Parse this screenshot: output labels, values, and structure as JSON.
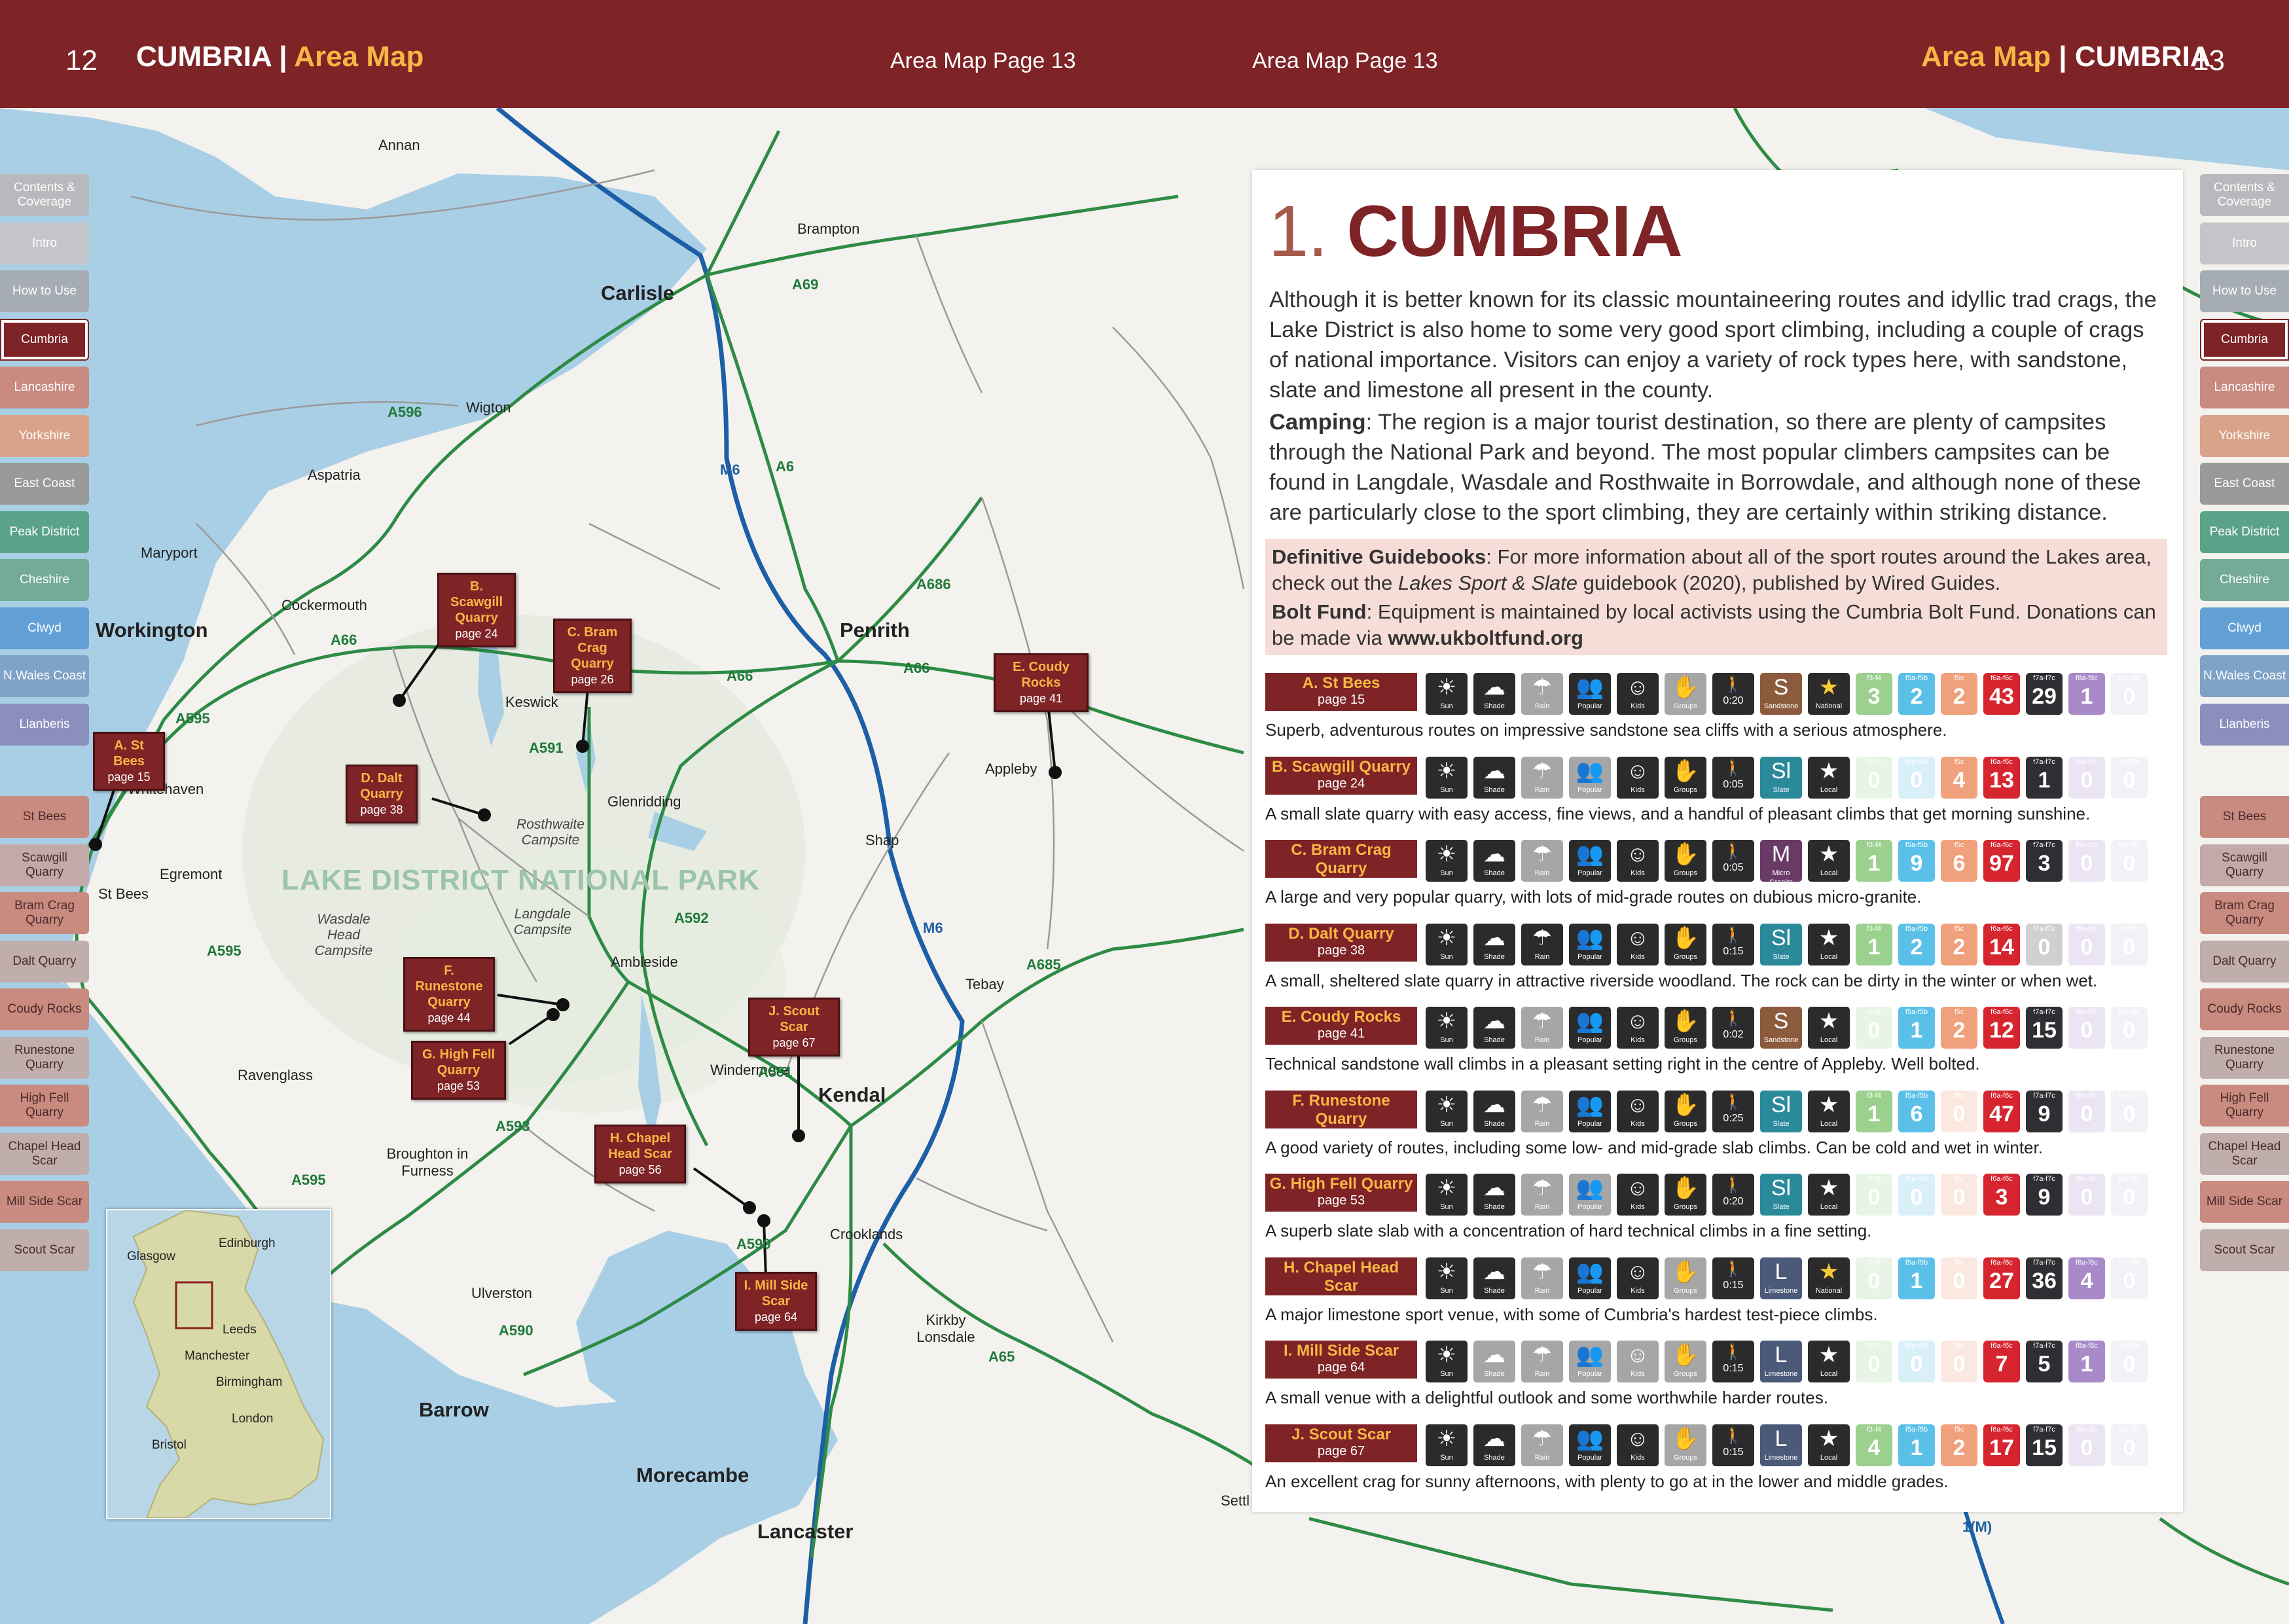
{
  "header": {
    "left_page_num": "12",
    "left_title": "CUMBRIA",
    "left_subtitle": "Area Map",
    "left_small": "Area Map Page 13",
    "right_small": "Area Map Page 13",
    "right_subtitle": "Area Map",
    "right_title": "CUMBRIA",
    "right_page_num": "13"
  },
  "colors": {
    "header": "#7e2326",
    "accent": "#f7b744",
    "road": "#1f7a3a",
    "motorway": "#1d5fa6",
    "sea": "#a9cfe6"
  },
  "tabs": [
    {
      "label": "Contents & Coverage",
      "color": "#b9b9bd"
    },
    {
      "label": "Intro",
      "color": "#c5c5c9"
    },
    {
      "label": "How to Use",
      "color": "#a6acb4"
    },
    {
      "label": "Cumbria",
      "color": "#7e2326",
      "active": true
    },
    {
      "label": "Lancashire",
      "color": "#c98a7f"
    },
    {
      "label": "Yorkshire",
      "color": "#d9a38a"
    },
    {
      "label": "East Coast",
      "color": "#9a9a9a"
    },
    {
      "label": "Peak District",
      "color": "#5aa389"
    },
    {
      "label": "Cheshire",
      "color": "#73ab96"
    },
    {
      "label": "Clwyd",
      "color": "#62a0d6"
    },
    {
      "label": "N.Wales Coast",
      "color": "#7fa2c7"
    },
    {
      "label": "Llanberis",
      "color": "#8b8fbe"
    }
  ],
  "crag_tabs": [
    {
      "label": "St Bees",
      "color": "#c98a7f"
    },
    {
      "label": "Scawgill Quarry",
      "color": "#c3a9a8"
    },
    {
      "label": "Bram Crag Quarry",
      "color": "#c98a7f"
    },
    {
      "label": "Dalt Quarry",
      "color": "#bfaeac"
    },
    {
      "label": "Coudy Rocks",
      "color": "#c98a7f"
    },
    {
      "label": "Runestone Quarry",
      "color": "#bfaeac"
    },
    {
      "label": "High Fell Quarry",
      "color": "#c98a7f"
    },
    {
      "label": "Chapel Head Scar",
      "color": "#bfaeac"
    },
    {
      "label": "Mill Side Scar",
      "color": "#c98a7f"
    },
    {
      "label": "Scout Scar",
      "color": "#bfaeac"
    }
  ],
  "map": {
    "park_label": "LAKE DISTRICT NATIONAL PARK",
    "places": [
      {
        "id": "annan",
        "name": "Annan"
      },
      {
        "id": "brampton",
        "name": "Brampton"
      },
      {
        "id": "carlisle",
        "name": "Carlisle",
        "big": true
      },
      {
        "id": "wigton",
        "name": "Wigton"
      },
      {
        "id": "aspatria",
        "name": "Aspatria"
      },
      {
        "id": "maryport",
        "name": "Maryport"
      },
      {
        "id": "cockermouth",
        "name": "Cockermouth"
      },
      {
        "id": "workington",
        "name": "Workington",
        "big": true
      },
      {
        "id": "keswick",
        "name": "Keswick"
      },
      {
        "id": "penrith",
        "name": "Penrith",
        "big": true
      },
      {
        "id": "appleby",
        "name": "Appleby"
      },
      {
        "id": "whitehaven",
        "name": "Whitehaven"
      },
      {
        "id": "egremont",
        "name": "Egremont"
      },
      {
        "id": "stbees",
        "name": "St Bees"
      },
      {
        "id": "glenridding",
        "name": "Glenridding"
      },
      {
        "id": "shap",
        "name": "Shap"
      },
      {
        "id": "tebay",
        "name": "Tebay"
      },
      {
        "id": "ambleside",
        "name": "Ambleside"
      },
      {
        "id": "ravenglass",
        "name": "Ravenglass"
      },
      {
        "id": "windermere",
        "name": "Windermere"
      },
      {
        "id": "kendal",
        "name": "Kendal",
        "big": true
      },
      {
        "id": "broughton",
        "name": "Broughton in Furness"
      },
      {
        "id": "crooklands",
        "name": "Crooklands"
      },
      {
        "id": "ulverston",
        "name": "Ulverston"
      },
      {
        "id": "kirkby",
        "name": "Kirkby Lonsdale"
      },
      {
        "id": "barrow",
        "name": "Barrow",
        "big": true
      },
      {
        "id": "morecambe",
        "name": "Morecambe",
        "big": true
      },
      {
        "id": "lancaster",
        "name": "Lancaster",
        "big": true
      },
      {
        "id": "settle",
        "name": "Settl"
      }
    ],
    "campsites": [
      {
        "id": "rosthwaite",
        "name": "Rosthwaite Campsite"
      },
      {
        "id": "wasdale",
        "name": "Wasdale Head Campsite"
      },
      {
        "id": "langdale",
        "name": "Langdale Campsite"
      }
    ],
    "roads": [
      "A69",
      "A6",
      "M6",
      "A595",
      "A596",
      "A66",
      "A686",
      "A591",
      "A592",
      "A685",
      "A593",
      "A590",
      "A65",
      "M6",
      "A66",
      "A66",
      "A595",
      "A591",
      "A590",
      "A595",
      "1(M)"
    ],
    "crags": [
      {
        "id": "A",
        "name": "A. St Bees",
        "page": "page 15"
      },
      {
        "id": "B",
        "name": "B. Scawgill Quarry",
        "page": "page 24"
      },
      {
        "id": "C",
        "name": "C. Bram Crag Quarry",
        "page": "page 26"
      },
      {
        "id": "D",
        "name": "D. Dalt Quarry",
        "page": "page 38"
      },
      {
        "id": "E",
        "name": "E. Coudy Rocks",
        "page": "page 41"
      },
      {
        "id": "F",
        "name": "F. Runestone Quarry",
        "page": "page 44"
      },
      {
        "id": "G",
        "name": "G. High Fell Quarry",
        "page": "page 53"
      },
      {
        "id": "H",
        "name": "H. Chapel Head Scar",
        "page": "page 56"
      },
      {
        "id": "I",
        "name": "I. Mill Side Scar",
        "page": "page 64"
      },
      {
        "id": "J",
        "name": "J. Scout Scar",
        "page": "page 67"
      }
    ],
    "inset_cities": [
      "Edinburgh",
      "Glasgow",
      "Leeds",
      "Manchester",
      "Birmingham",
      "London",
      "Bristol"
    ]
  },
  "panel": {
    "number": "1.",
    "title": "CUMBRIA",
    "intro": "Although it is better known for its classic mountaineering routes and idyllic trad crags, the Lake District is also home to some very good sport climbing, including a couple of crags of national importance. Visitors can enjoy a variety of rock types here, with sandstone, slate and limestone all present in the county.",
    "camping_label": "Camping",
    "camping_text": ": The region is a major tourist destination, so there are plenty of campsites through the National Park and beyond. The most popular climbers campsites can be found in Langdale, Wasdale and Rosthwaite in Borrowdale, and although none of these are particularly close to the sport climbing, they are certainly within striking distance.",
    "guide_label": "Definitive Guidebooks",
    "guide_text_1": ": For more information about all of the sport routes around the Lakes area, check out the ",
    "guide_title": "Lakes Sport & Slate",
    "guide_text_2": " guidebook (2020), published by Wired Guides.",
    "bolt_label": "Bolt Fund",
    "bolt_text": ": Equipment is maintained by local activists using the Cumbria Bolt Fund. Donations can be made via ",
    "bolt_url": "www.ukboltfund.org"
  },
  "icon_labels": [
    "Sun",
    "Shade",
    "Rain",
    "Popular",
    "Kids",
    "Groups"
  ],
  "grade_bands": [
    "f3-f4",
    "f5a-f5b",
    "f5c",
    "f6a-f6c",
    "f7a-f7c",
    "f8a-f8c",
    "f9a-f9c"
  ],
  "grade_colors": [
    "#9bd08f",
    "#5bc0e8",
    "#f0a07a",
    "#d7252f",
    "#2f2f33",
    "#a88ac8",
    "#c4c9d6"
  ],
  "crag_list": [
    {
      "name": "A. St Bees",
      "page": "page 15",
      "sun": true,
      "shade": true,
      "rain": false,
      "popular": true,
      "kids": true,
      "groups": false,
      "time": "0:20",
      "rock": "S",
      "rock_name": "Sandstone",
      "rock_color": "#8c5a3c",
      "status": "National",
      "grades": [
        "3",
        "2",
        "2",
        "43",
        "29",
        "1",
        "0"
      ],
      "desc": "Superb, adventurous routes on impressive sandstone sea cliffs with a serious atmosphere."
    },
    {
      "name": "B. Scawgill Quarry",
      "page": "page 24",
      "sun": true,
      "shade": true,
      "rain": false,
      "popular": false,
      "kids": true,
      "groups": true,
      "time": "0:05",
      "rock": "Sl",
      "rock_name": "Slate",
      "rock_color": "#2b8a9a",
      "status": "Local",
      "grades": [
        "0",
        "0",
        "4",
        "13",
        "1",
        "0",
        "0"
      ],
      "desc": "A small slate quarry with easy access, fine views, and a handful of pleasant climbs that get morning sunshine."
    },
    {
      "name": "C. Bram Crag Quarry",
      "page": "page 26",
      "sun": true,
      "shade": true,
      "rain": false,
      "popular": true,
      "kids": true,
      "groups": true,
      "time": "0:05",
      "rock": "M",
      "rock_name": "Micro Granite",
      "rock_color": "#6a3a66",
      "status": "Local",
      "grades": [
        "1",
        "9",
        "6",
        "97",
        "3",
        "0",
        "0"
      ],
      "desc": "A large and very popular quarry, with lots of mid-grade routes on dubious micro-granite."
    },
    {
      "name": "D. Dalt Quarry",
      "page": "page 38",
      "sun": true,
      "shade": true,
      "rain": true,
      "popular": true,
      "kids": true,
      "groups": true,
      "time": "0:15",
      "rock": "Sl",
      "rock_name": "Slate",
      "rock_color": "#2b8a9a",
      "status": "Local",
      "grades": [
        "1",
        "2",
        "2",
        "14",
        "0",
        "0",
        "0"
      ],
      "desc": "A small, sheltered slate quarry in attractive riverside woodland. The rock can be dirty in the winter or when wet."
    },
    {
      "name": "E. Coudy Rocks",
      "page": "page 41",
      "sun": true,
      "shade": true,
      "rain": false,
      "popular": true,
      "kids": true,
      "groups": true,
      "time": "0:02",
      "rock": "S",
      "rock_name": "Sandstone",
      "rock_color": "#8c5a3c",
      "status": "Local",
      "grades": [
        "0",
        "1",
        "2",
        "12",
        "15",
        "0",
        "0"
      ],
      "desc": "Technical sandstone wall climbs in a pleasant setting right in the centre of Appleby. Well bolted."
    },
    {
      "name": "F. Runestone Quarry",
      "page": "page 44",
      "sun": true,
      "shade": true,
      "rain": false,
      "popular": true,
      "kids": true,
      "groups": true,
      "time": "0:25",
      "rock": "Sl",
      "rock_name": "Slate",
      "rock_color": "#2b8a9a",
      "status": "Local",
      "grades": [
        "1",
        "6",
        "0",
        "47",
        "9",
        "0",
        "0"
      ],
      "desc": "A good variety of routes, including some low- and mid-grade slab climbs. Can be cold and wet in winter."
    },
    {
      "name": "G. High Fell Quarry",
      "page": "page 53",
      "sun": true,
      "shade": true,
      "rain": false,
      "popular": false,
      "kids": true,
      "groups": true,
      "time": "0:20",
      "rock": "Sl",
      "rock_name": "Slate",
      "rock_color": "#2b8a9a",
      "status": "Local",
      "grades": [
        "0",
        "0",
        "0",
        "3",
        "9",
        "0",
        "0"
      ],
      "desc": "A superb slate slab with a concentration of hard technical climbs in a fine setting."
    },
    {
      "name": "H. Chapel Head Scar",
      "page": "page 56",
      "sun": true,
      "shade": true,
      "rain": false,
      "popular": true,
      "kids": true,
      "groups": false,
      "time": "0:15",
      "rock": "L",
      "rock_name": "Limestone",
      "rock_color": "#4a5a78",
      "status": "National",
      "grades": [
        "0",
        "1",
        "0",
        "27",
        "36",
        "4",
        "0"
      ],
      "desc": "A major limestone sport venue, with some of Cumbria's hardest test-piece climbs."
    },
    {
      "name": "I. Mill Side Scar",
      "page": "page 64",
      "sun": true,
      "shade": false,
      "rain": false,
      "popular": false,
      "kids": false,
      "groups": false,
      "time": "0:15",
      "rock": "L",
      "rock_name": "Limestone",
      "rock_color": "#4a5a78",
      "status": "Local",
      "grades": [
        "0",
        "0",
        "0",
        "7",
        "5",
        "1",
        "0"
      ],
      "desc": "A small venue with a delightful outlook and some worthwhile harder routes."
    },
    {
      "name": "J. Scout Scar",
      "page": "page 67",
      "sun": true,
      "shade": true,
      "rain": false,
      "popular": true,
      "kids": true,
      "groups": false,
      "time": "0:15",
      "rock": "L",
      "rock_name": "Limestone",
      "rock_color": "#4a5a78",
      "status": "Local",
      "grades": [
        "4",
        "1",
        "2",
        "17",
        "15",
        "0",
        "0"
      ],
      "desc": "An excellent crag for sunny afternoons, with plenty to go at in the lower and middle grades."
    }
  ]
}
